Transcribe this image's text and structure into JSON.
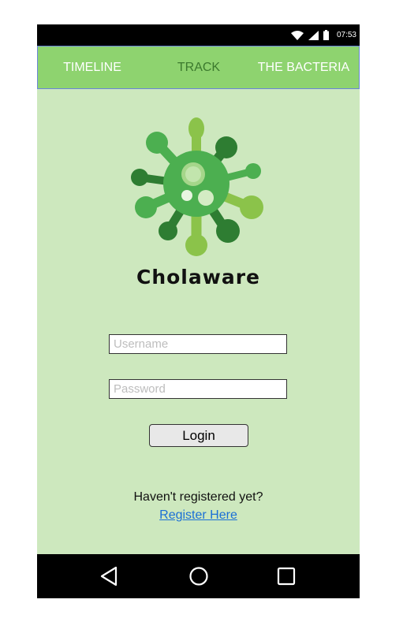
{
  "status_bar": {
    "time": "07:53",
    "icons": [
      "wifi-icon",
      "signal-icon",
      "battery-icon"
    ]
  },
  "tabs": [
    {
      "label": "TIMELINE",
      "active": false
    },
    {
      "label": "TRACK",
      "active": true
    },
    {
      "label": "THE BACTERIA",
      "active": false
    }
  ],
  "app": {
    "name": "Cholaware",
    "logo_icon": "bacteria-logo-icon"
  },
  "login_form": {
    "username_placeholder": "Username",
    "username_value": "",
    "password_placeholder": "Password",
    "password_value": "",
    "login_label": "Login"
  },
  "register": {
    "prompt": "Haven't registered yet?",
    "link_label": "Register Here"
  },
  "nav_bar": {
    "icons": [
      "back-icon",
      "home-icon",
      "recent-apps-icon"
    ]
  },
  "colors": {
    "background": "#cde8be",
    "tab_bar": "#8ed36f",
    "tab_text": "#ffffff",
    "tab_active_text": "#3c7a2e",
    "link": "#1a6fd6"
  }
}
